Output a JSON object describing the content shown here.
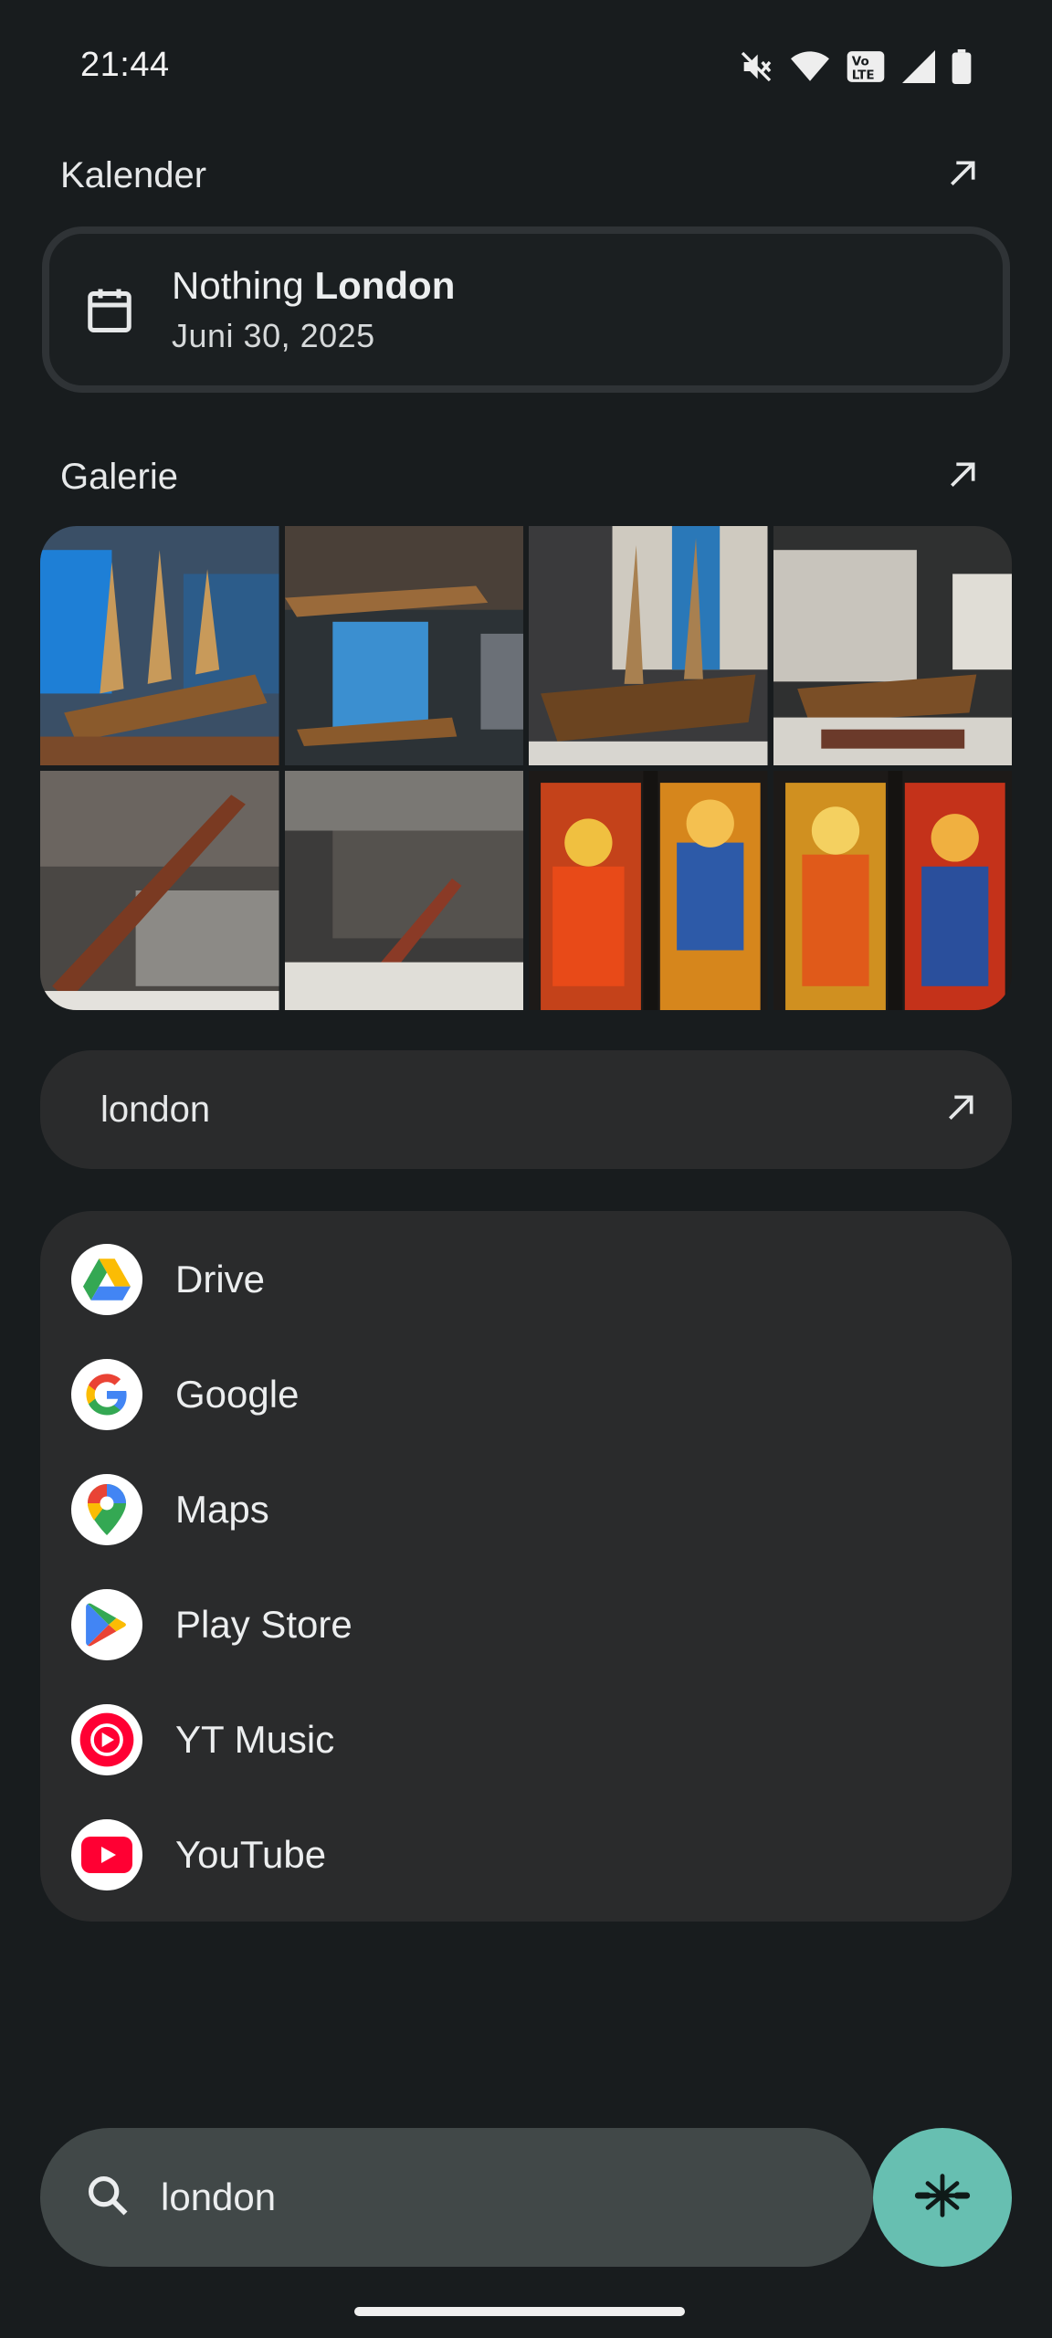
{
  "status_bar": {
    "time": "21:44",
    "icons": [
      "mute-icon",
      "wifi-icon",
      "volte-icon",
      "signal-icon",
      "battery-icon"
    ]
  },
  "calendar": {
    "section_title": "Kalender",
    "event_prefix": "Nothing",
    "event_highlight": "London",
    "event_date": "Juni 30, 2025"
  },
  "gallery": {
    "section_title": "Galerie",
    "photos": [
      "ship-model-1",
      "ship-model-2",
      "ship-model-3",
      "ship-model-4",
      "musket-display-1",
      "musket-display-2",
      "stained-glass-1",
      "stained-glass-2"
    ]
  },
  "web_search": {
    "label": "london"
  },
  "apps": [
    {
      "name": "Drive",
      "icon": "drive-icon"
    },
    {
      "name": "Google",
      "icon": "google-icon"
    },
    {
      "name": "Maps",
      "icon": "maps-icon"
    },
    {
      "name": "Play Store",
      "icon": "play-store-icon"
    },
    {
      "name": "YT Music",
      "icon": "yt-music-icon"
    },
    {
      "name": "YouTube",
      "icon": "youtube-icon"
    }
  ],
  "search": {
    "value": "london",
    "placeholder": ""
  },
  "colors": {
    "background": "#181c1e",
    "card": "#2a2b2c",
    "search_bar": "#414848",
    "fab": "#67bfb1"
  }
}
